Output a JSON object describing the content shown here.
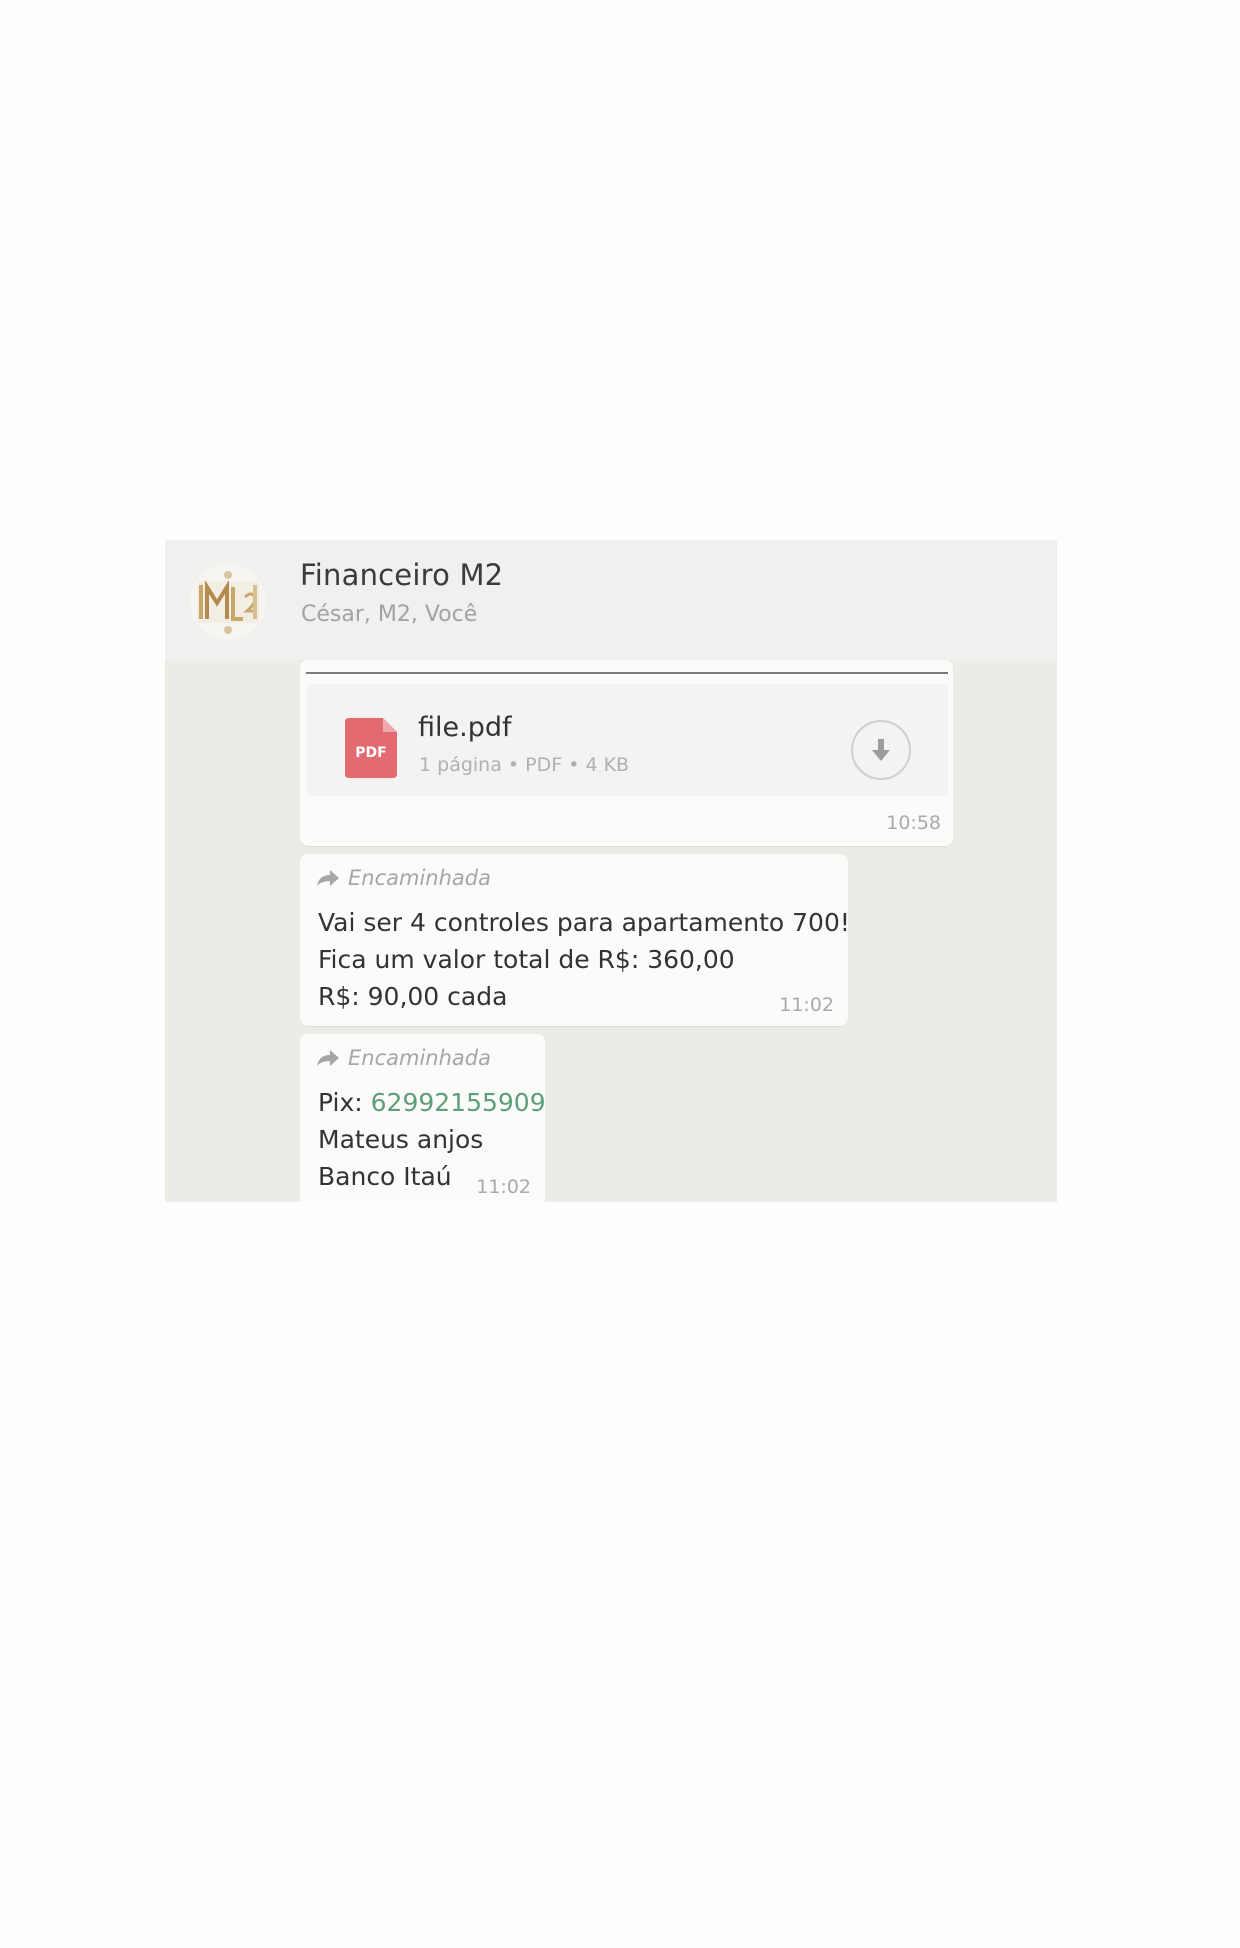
{
  "chat": {
    "title": "Financeiro M2",
    "participants": "César, M2, Você",
    "avatar_text": "M2"
  },
  "messages": {
    "document": {
      "file_name": "file.pdf",
      "icon_label": "PDF",
      "meta": "1 página • PDF • 4 KB",
      "time": "10:58",
      "download_icon": "download-icon"
    },
    "forward_label": "Encaminhada",
    "message1": {
      "lines": [
        "Vai ser 4 controles para apartamento 700!",
        "Fica um valor total de R$: 360,00",
        "R$: 90,00 cada"
      ],
      "time": "11:02"
    },
    "message2": {
      "pix_label": "Pix: ",
      "pix_number": "62992155909",
      "lines": [
        "Mateus anjos",
        "Banco Itaú"
      ],
      "time": "11:02"
    }
  },
  "colors": {
    "pdf_red": "#e26a70",
    "link_green": "#5f9e78",
    "chat_background": "#ecebe5"
  }
}
